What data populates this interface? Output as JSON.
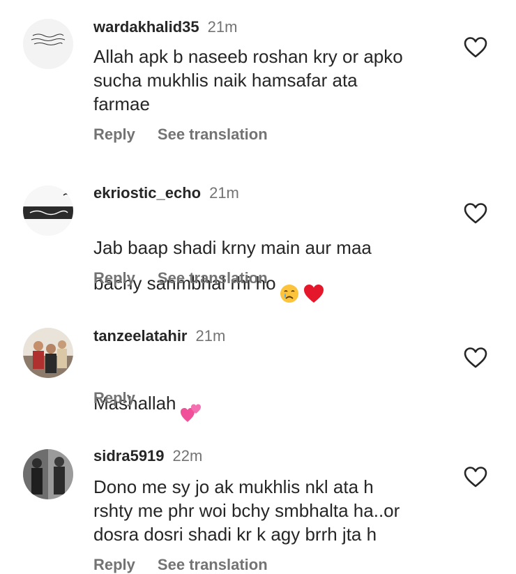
{
  "comments": [
    {
      "username": "wardakhalid35",
      "time": "21m",
      "text": "Allah apk b naseeb roshan kry or apko\nsucha mukhlis naik hamsafar ata\nfarmae",
      "reply": "Reply",
      "see_translation": "See translation"
    },
    {
      "username": "ekriostic_echo",
      "time": "21m",
      "text": "Jab baap shadi krny main aur maa\nbachy sanmbhal rhi ho",
      "emojis": [
        "crying-face",
        "red-heart"
      ],
      "reply": "Reply",
      "see_translation": "See translation"
    },
    {
      "username": "tanzeelatahir",
      "time": "21m",
      "text": "Mashallah",
      "emojis": [
        "two-hearts"
      ],
      "reply": "Reply"
    },
    {
      "username": "sidra5919",
      "time": "22m",
      "text": "Dono me sy jo ak mukhlis nkl ata h\nrshty me phr woi bchy smbhalta ha..or\ndosra dosri shadi kr k agy brrh jta h",
      "reply": "Reply",
      "see_translation": "See translation"
    }
  ],
  "colors": {
    "primary_text": "#262626",
    "secondary_text": "#737373",
    "heart_stroke": "#262626"
  }
}
